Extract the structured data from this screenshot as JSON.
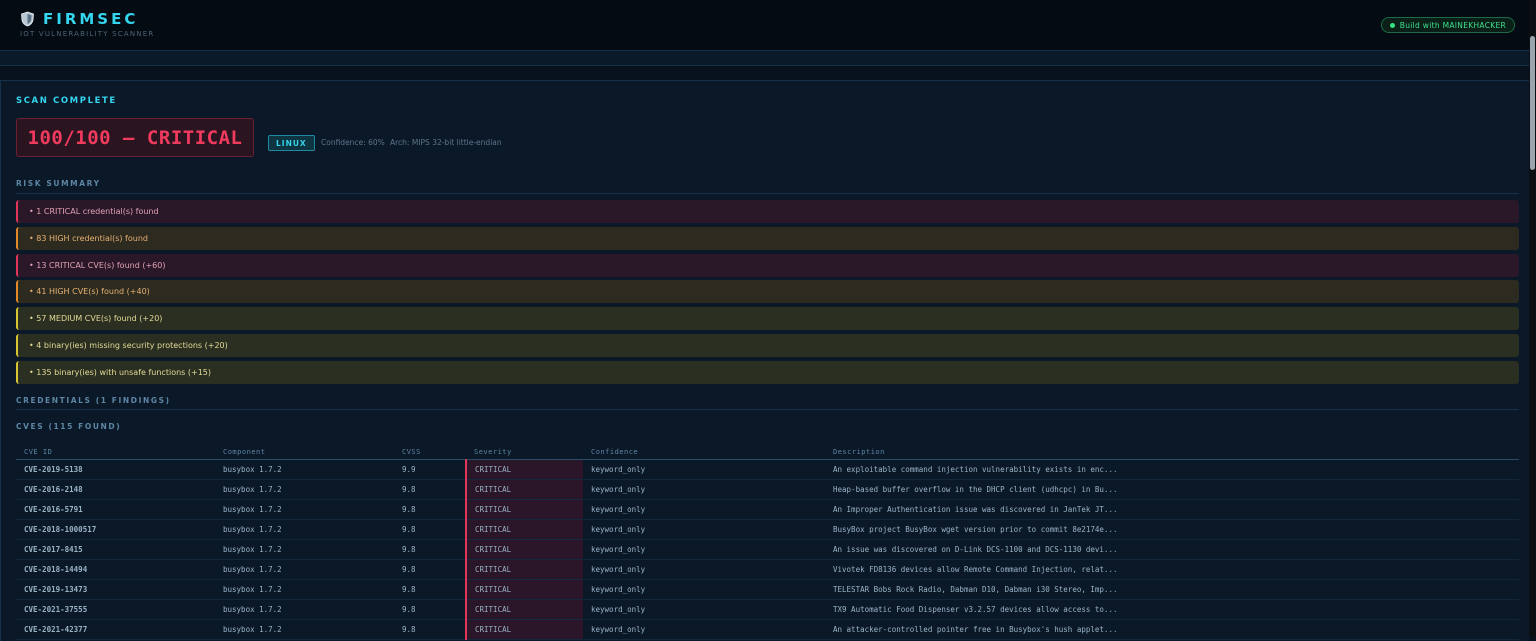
{
  "header": {
    "title": "FIRMSEC",
    "subtitle": "IOT VULNERABILITY SCANNER",
    "badge": "Build with MAINEKHACKER"
  },
  "scan": {
    "title": "SCAN COMPLETE",
    "score": "100/100 — CRITICAL",
    "os": "LINUX",
    "confidence": "Confidence: 60%",
    "arch": "Arch: MIPS 32-bit little-endian"
  },
  "risk_summary": {
    "label": "RISK SUMMARY",
    "items": [
      {
        "text": "• 1 CRITICAL credential(s) found",
        "level": "critical"
      },
      {
        "text": "• 83 HIGH credential(s) found",
        "level": "high"
      },
      {
        "text": "• 13 CRITICAL CVE(s) found (+60)",
        "level": "critical"
      },
      {
        "text": "• 41 HIGH CVE(s) found (+40)",
        "level": "high"
      },
      {
        "text": "• 57 MEDIUM CVE(s) found (+20)",
        "level": "medium"
      },
      {
        "text": "• 4 binary(ies) missing security protections (+20)",
        "level": "medium"
      },
      {
        "text": "• 135 binary(ies) with unsafe functions (+15)",
        "level": "medium"
      }
    ]
  },
  "credentials": {
    "label": "CREDENTIALS (1 FINDINGS)"
  },
  "cves": {
    "label": "CVES (115 FOUND)",
    "columns": [
      "CVE ID",
      "Component",
      "CVSS",
      "Severity",
      "Confidence",
      "Description"
    ],
    "rows": [
      [
        "CVE-2019-5138",
        "busybox 1.7.2",
        "9.9",
        "CRITICAL",
        "keyword_only",
        "An exploitable command injection vulnerability exists in enc..."
      ],
      [
        "CVE-2016-2148",
        "busybox 1.7.2",
        "9.8",
        "CRITICAL",
        "keyword_only",
        "Heap-based buffer overflow in the DHCP client (udhcpc) in Bu..."
      ],
      [
        "CVE-2016-5791",
        "busybox 1.7.2",
        "9.8",
        "CRITICAL",
        "keyword_only",
        "An Improper Authentication issue was discovered in JanTek JT..."
      ],
      [
        "CVE-2018-1000517",
        "busybox 1.7.2",
        "9.8",
        "CRITICAL",
        "keyword_only",
        "BusyBox project BusyBox wget version prior to commit 8e2174e..."
      ],
      [
        "CVE-2017-8415",
        "busybox 1.7.2",
        "9.8",
        "CRITICAL",
        "keyword_only",
        "An issue was discovered on D-Link DCS-1100 and DCS-1130 devi..."
      ],
      [
        "CVE-2018-14494",
        "busybox 1.7.2",
        "9.8",
        "CRITICAL",
        "keyword_only",
        "Vivotek FD8136 devices allow Remote Command Injection, relat..."
      ],
      [
        "CVE-2019-13473",
        "busybox 1.7.2",
        "9.8",
        "CRITICAL",
        "keyword_only",
        "TELESTAR Bobs Rock Radio, Dabman D10, Dabman i30 Stereo, Imp..."
      ],
      [
        "CVE-2021-37555",
        "busybox 1.7.2",
        "9.8",
        "CRITICAL",
        "keyword_only",
        "TX9 Automatic Food Dispenser v3.2.57 devices allow access to..."
      ],
      [
        "CVE-2021-42377",
        "busybox 1.7.2",
        "9.8",
        "CRITICAL",
        "keyword_only",
        "An attacker-controlled pointer free in Busybox's hush applet..."
      ]
    ]
  },
  "icons": {
    "brand": "shield-icon",
    "status": "status-dot"
  },
  "colors": {
    "accent": "#34d5ee",
    "critical": "#e0365a",
    "high": "#e08a2a",
    "medium": "#d8c531",
    "ok": "#33e37f"
  }
}
